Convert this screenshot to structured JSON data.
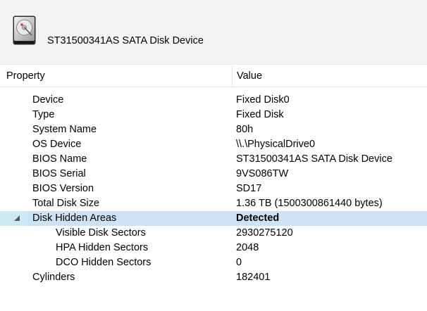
{
  "header": {
    "device_title": "ST31500341AS SATA Disk Device",
    "icon": "hard-disk-icon"
  },
  "table": {
    "columns": {
      "property": "Property",
      "value": "Value"
    },
    "rows": [
      {
        "property": "Device",
        "value": "Fixed Disk0"
      },
      {
        "property": "Type",
        "value": "Fixed Disk"
      },
      {
        "property": "System Name",
        "value": "80h"
      },
      {
        "property": "OS Device",
        "value": "\\\\.\\PhysicalDrive0"
      },
      {
        "property": "BIOS Name",
        "value": "ST31500341AS SATA Disk Device"
      },
      {
        "property": "BIOS Serial",
        "value": "9VS086TW"
      },
      {
        "property": "BIOS Version",
        "value": "SD17"
      },
      {
        "property": "Total Disk Size",
        "value": "1.36 TB (1500300861440 bytes)"
      },
      {
        "property": "Disk Hidden Areas",
        "value": "Detected"
      },
      {
        "property": "Visible Disk Sectors",
        "value": "2930275120"
      },
      {
        "property": "HPA Hidden Sectors",
        "value": "2048"
      },
      {
        "property": "DCO Hidden Sectors",
        "value": "0"
      },
      {
        "property": "Cylinders",
        "value": "182401"
      }
    ]
  },
  "colors": {
    "header_bg": "#f3f3f3",
    "selection_bg": "#cde2f4"
  }
}
